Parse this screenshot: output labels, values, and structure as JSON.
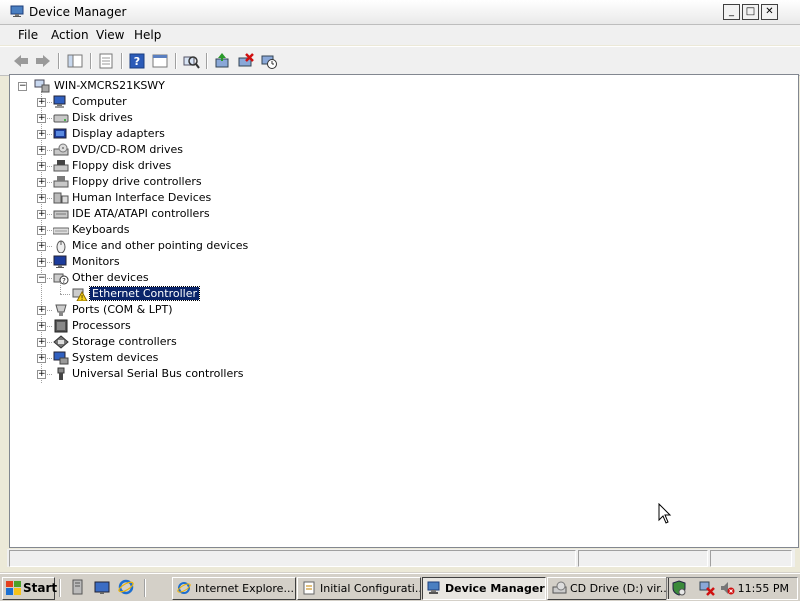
{
  "window": {
    "title": "Device Manager",
    "controls": {
      "minimize": "_",
      "maximize": "□",
      "close": "✕"
    }
  },
  "menubar": [
    "File",
    "Action",
    "View",
    "Help"
  ],
  "toolbar": {
    "buttons": [
      "back-icon",
      "forward-icon",
      "show-hide-tree-icon",
      "properties-icon",
      "help-icon",
      "view-icon",
      "scan-hardware-icon",
      "update-driver-icon",
      "uninstall-icon",
      "disable-icon"
    ]
  },
  "tree": {
    "root": "WIN-XMCRS21KSWY",
    "categories": [
      {
        "label": "Computer",
        "icon": "computer-icon"
      },
      {
        "label": "Disk drives",
        "icon": "disk-drive-icon"
      },
      {
        "label": "Display adapters",
        "icon": "display-adapter-icon"
      },
      {
        "label": "DVD/CD-ROM drives",
        "icon": "dvd-drive-icon"
      },
      {
        "label": "Floppy disk drives",
        "icon": "floppy-drive-icon"
      },
      {
        "label": "Floppy drive controllers",
        "icon": "floppy-controller-icon"
      },
      {
        "label": "Human Interface Devices",
        "icon": "hid-icon"
      },
      {
        "label": "IDE ATA/ATAPI controllers",
        "icon": "ide-controller-icon"
      },
      {
        "label": "Keyboards",
        "icon": "keyboard-icon"
      },
      {
        "label": "Mice and other pointing devices",
        "icon": "mouse-icon"
      },
      {
        "label": "Monitors",
        "icon": "monitor-icon"
      },
      {
        "label": "Other devices",
        "icon": "unknown-device-icon",
        "expanded": true,
        "children": [
          {
            "label": "Ethernet Controller",
            "icon": "warning-device-icon",
            "selected": true
          }
        ]
      },
      {
        "label": "Ports (COM & LPT)",
        "icon": "port-icon"
      },
      {
        "label": "Processors",
        "icon": "processor-icon"
      },
      {
        "label": "Storage controllers",
        "icon": "storage-controller-icon"
      },
      {
        "label": "System devices",
        "icon": "system-device-icon"
      },
      {
        "label": "Universal Serial Bus controllers",
        "icon": "usb-icon"
      }
    ]
  },
  "taskbar": {
    "start_label": "Start",
    "tasks": [
      {
        "label": "Internet Explore...",
        "icon": "ie-icon"
      },
      {
        "label": "Initial Configurati...",
        "icon": "config-icon"
      },
      {
        "label": "Device Manager",
        "icon": "device-manager-icon",
        "active": true
      },
      {
        "label": "CD Drive (D:) vir...",
        "icon": "cd-drive-icon"
      }
    ],
    "clock": "11:55 PM"
  }
}
